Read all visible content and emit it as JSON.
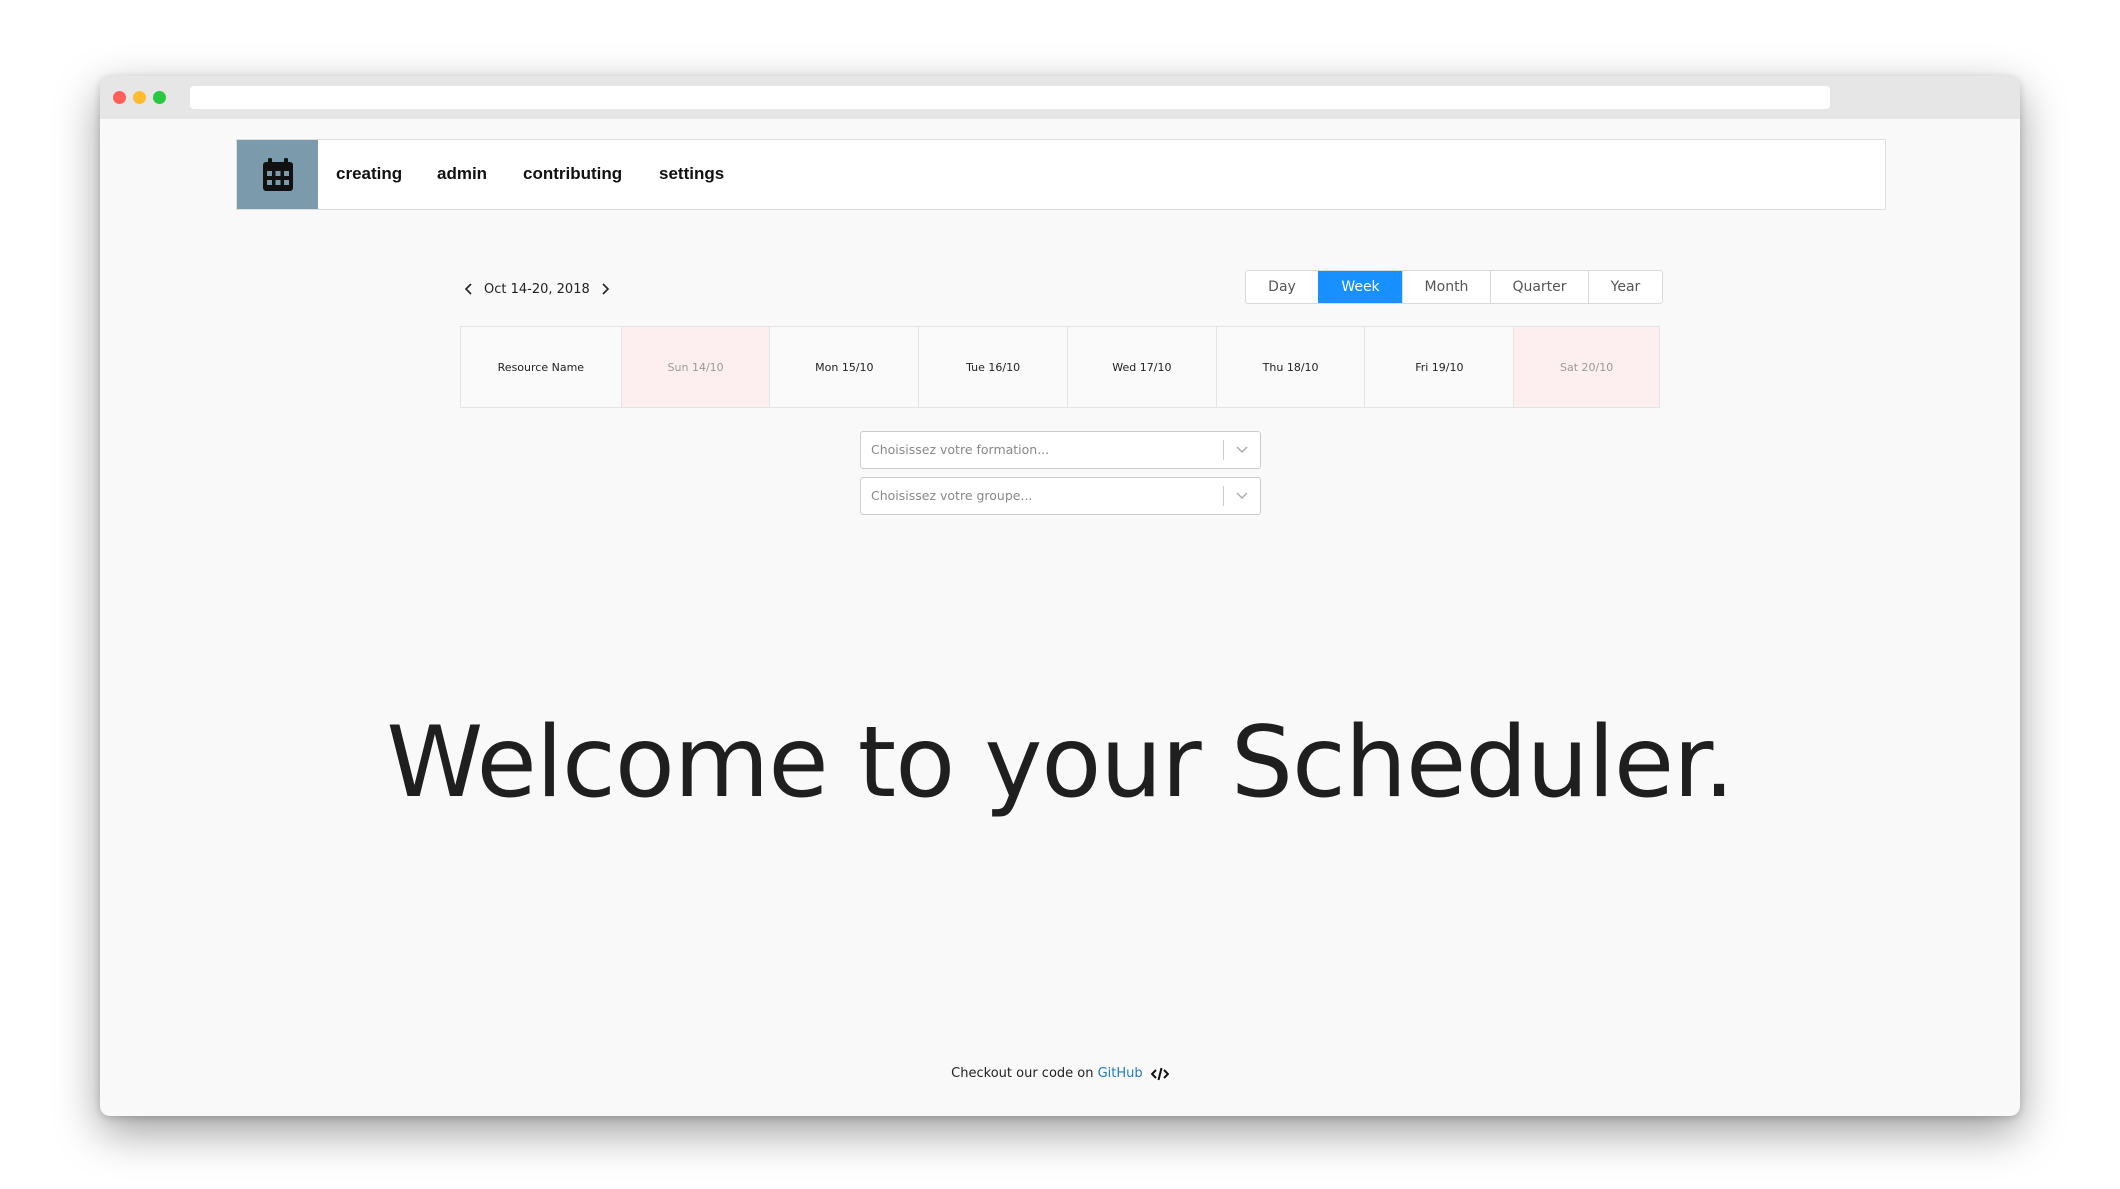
{
  "nav": {
    "logo_icon": "calendar-icon",
    "items": [
      {
        "label": "creating"
      },
      {
        "label": "admin"
      },
      {
        "label": "contributing"
      },
      {
        "label": "settings"
      }
    ]
  },
  "scheduler": {
    "date_range": "Oct 14-20, 2018",
    "views": [
      {
        "label": "Day",
        "active": false
      },
      {
        "label": "Week",
        "active": true
      },
      {
        "label": "Month",
        "active": false
      },
      {
        "label": "Quarter",
        "active": false
      },
      {
        "label": "Year",
        "active": false
      }
    ],
    "headers": [
      {
        "label": "Resource Name",
        "weekend": false
      },
      {
        "label": "Sun 14/10",
        "weekend": true
      },
      {
        "label": "Mon 15/10",
        "weekend": false
      },
      {
        "label": "Tue 16/10",
        "weekend": false
      },
      {
        "label": "Wed 17/10",
        "weekend": false
      },
      {
        "label": "Thu 18/10",
        "weekend": false
      },
      {
        "label": "Fri 19/10",
        "weekend": false
      },
      {
        "label": "Sat 20/10",
        "weekend": true
      }
    ]
  },
  "filters": {
    "formation_placeholder": "Choisissez votre formation...",
    "groupe_placeholder": "Choisissez votre groupe..."
  },
  "welcome": "Welcome to your Scheduler.",
  "footer": {
    "text": "Checkout our code on",
    "link": "GitHub",
    "icon": "code-icon"
  },
  "colors": {
    "accent": "#1890ff",
    "logo_bg": "#7b9aab",
    "weekend_bg": "#fdeff0",
    "link": "#1f7ac9"
  }
}
